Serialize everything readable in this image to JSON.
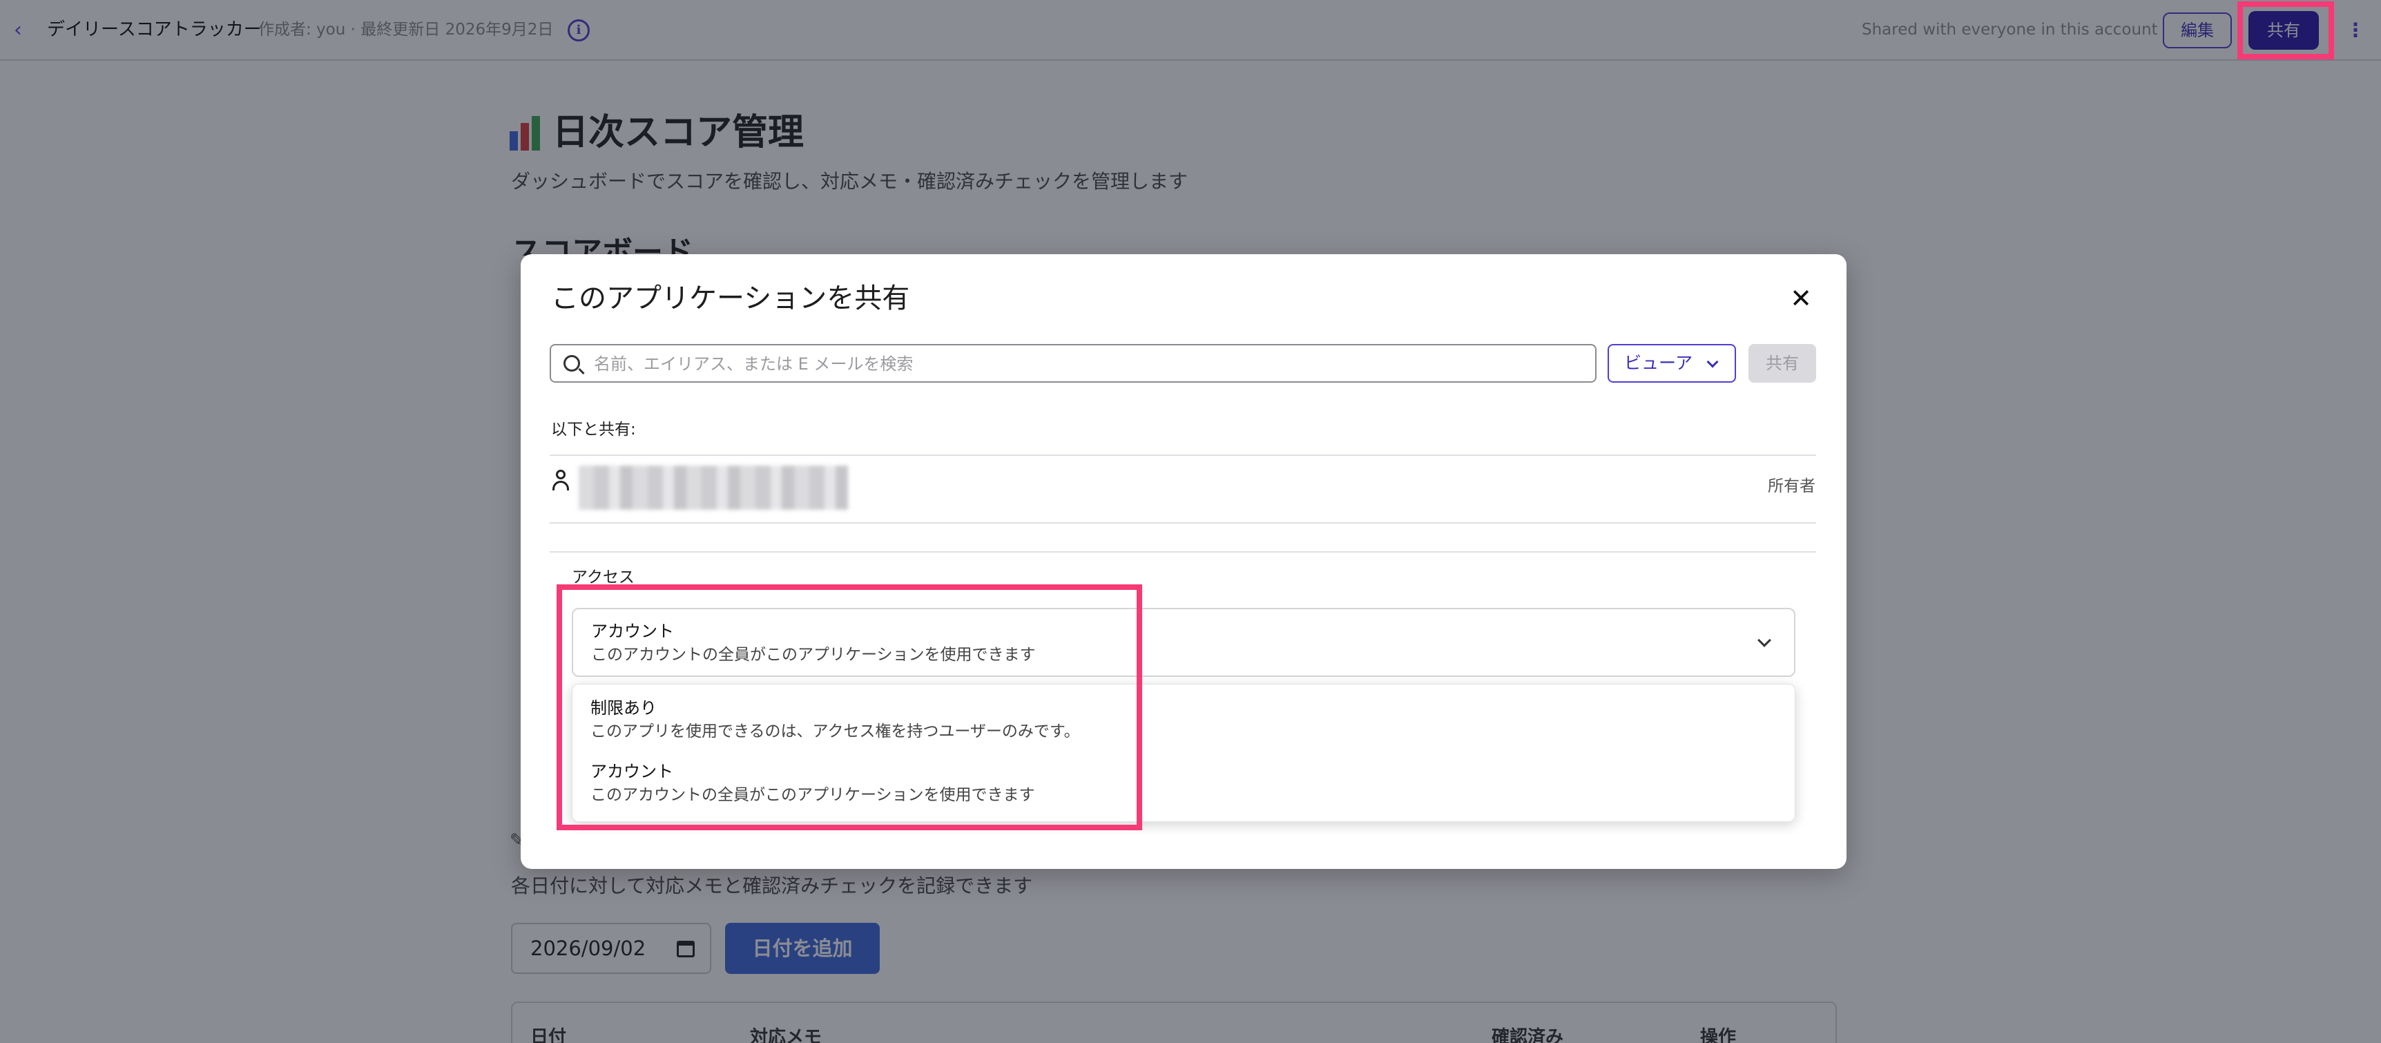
{
  "topbar": {
    "back_icon": "chevron-left-icon",
    "app_title": "デイリースコアトラッカー",
    "meta": "作成者: you · 最終更新日 2026年9月2日",
    "info_icon": "info-icon",
    "shared_status": "Shared with everyone in this account",
    "edit_label": "編集",
    "share_label": "共有",
    "more_icon": "kebab-icon"
  },
  "page": {
    "title": "日次スコア管理",
    "subtitle": "ダッシュボードでスコアを確認し、対応メモ・確認済みチェックを管理します",
    "section_title": "スコアボード",
    "memo_description": "各日付に対して対応メモと確認済みチェックを記録できます",
    "date_value": "2026/09/02",
    "add_date_label": "日付を追加",
    "table_headers": [
      "日付",
      "対応メモ",
      "確認済み",
      "操作"
    ]
  },
  "modal": {
    "title": "このアプリケーションを共有",
    "close_icon": "close-icon",
    "search_placeholder": "名前、エイリアス、または E メールを検索",
    "role_label": "ビューア",
    "share_label": "共有",
    "shared_with_label": "以下と共有:",
    "owner_role": "所有者",
    "access_label": "アクセス",
    "access_selected": {
      "title": "アカウント",
      "description": "このアカウントの全員がこのアプリケーションを使用できます"
    },
    "access_options": [
      {
        "title": "制限あり",
        "description": "このアプリを使用できるのは、アクセス権を持つユーザーのみです。"
      },
      {
        "title": "アカウント",
        "description": "このアカウントの全員がこのアプリケーションを使用できます"
      }
    ]
  },
  "colors": {
    "accent": "#2a17a8",
    "highlight": "#f53a76",
    "primary_button": "#3d68d8"
  }
}
